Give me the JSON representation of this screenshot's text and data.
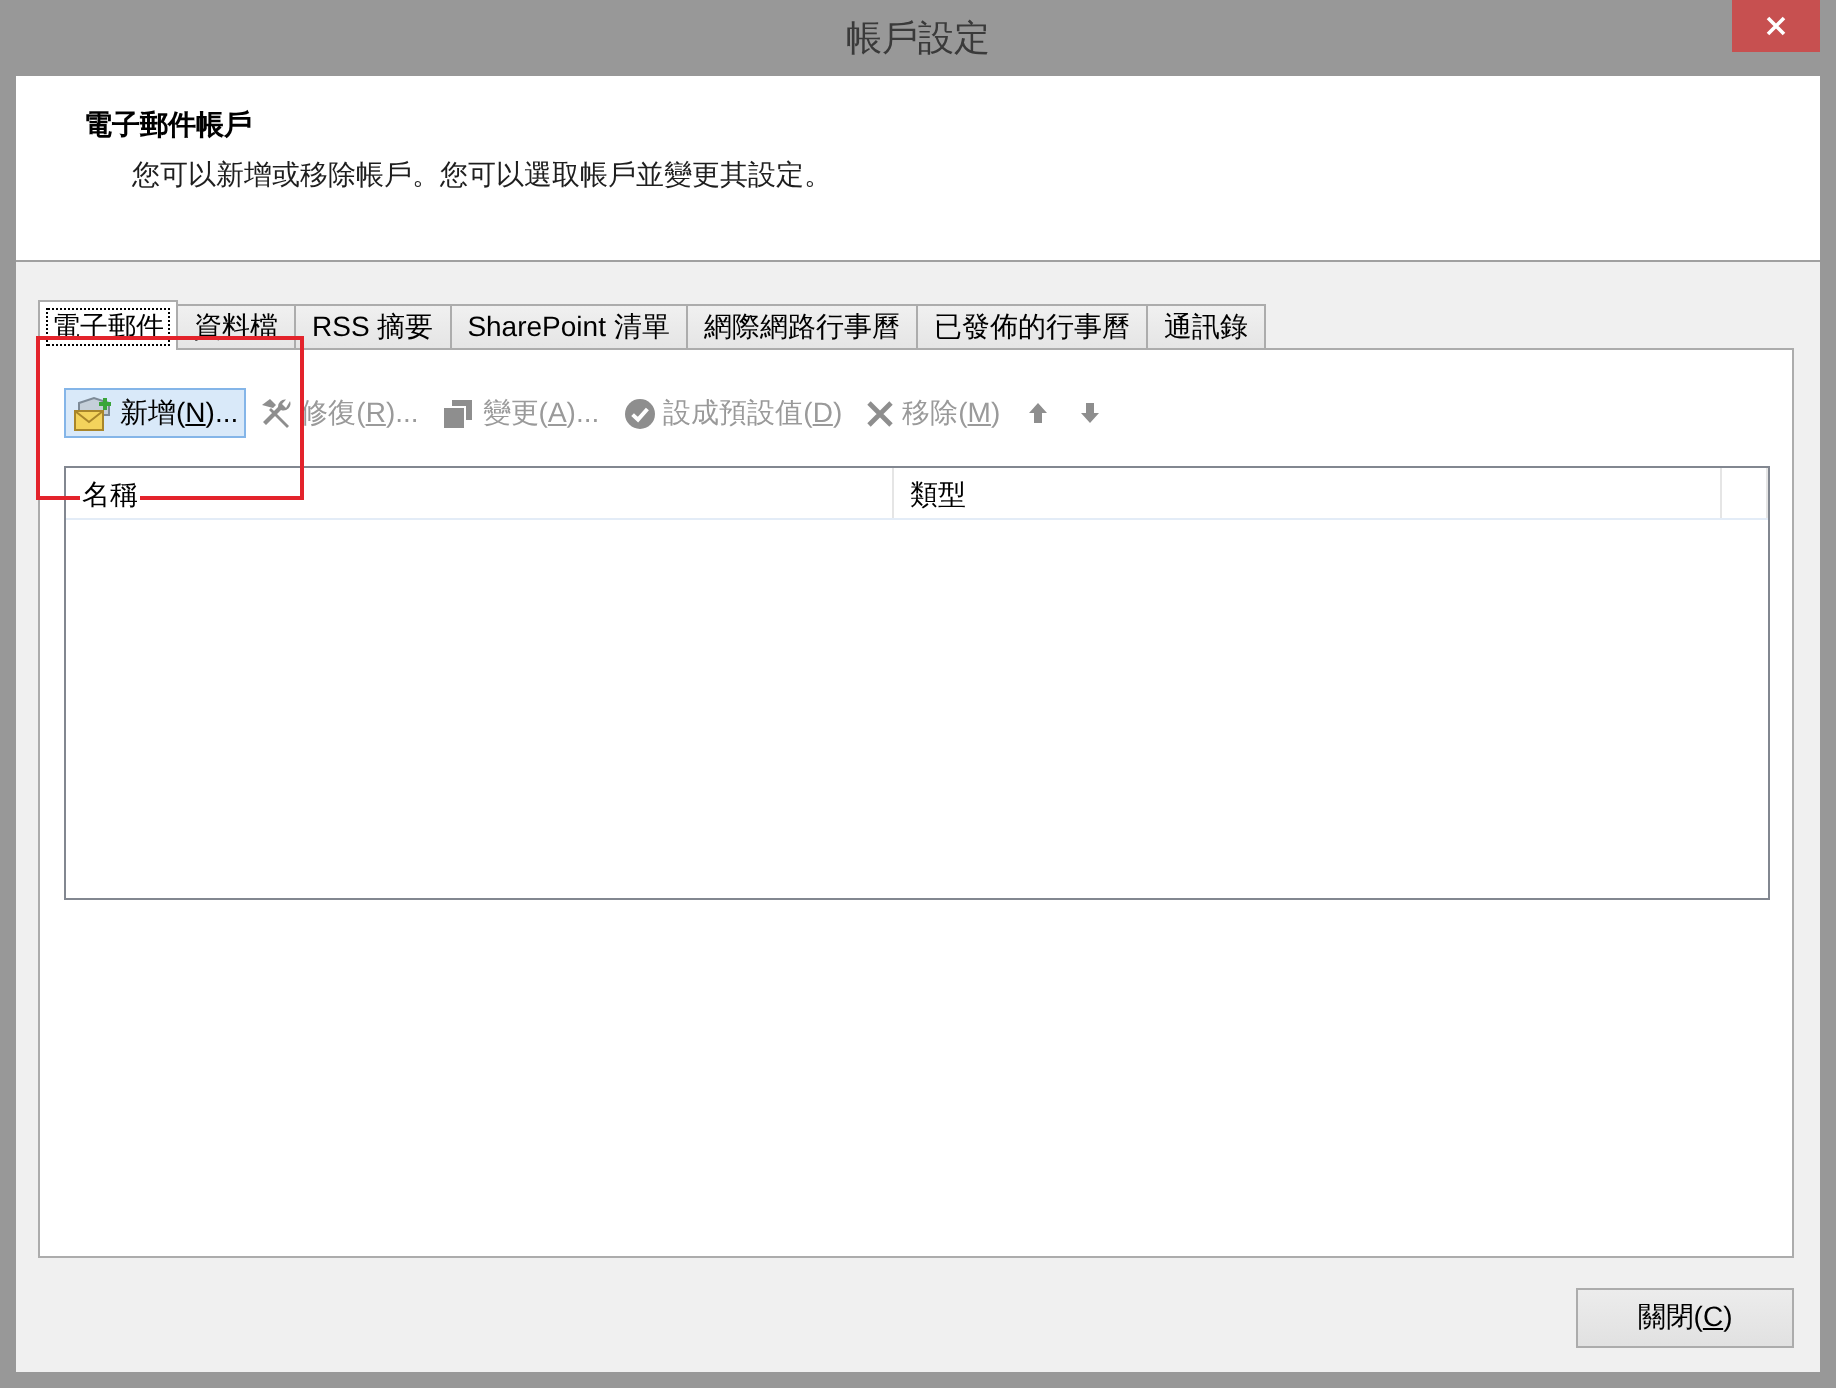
{
  "window": {
    "title": "帳戶設定"
  },
  "header": {
    "title": "電子郵件帳戶",
    "description": "您可以新增或移除帳戶。您可以選取帳戶並變更其設定。"
  },
  "tabs": [
    {
      "label": "電子郵件",
      "selected": true,
      "focused": true
    },
    {
      "label": "資料檔",
      "selected": false,
      "focused": false
    },
    {
      "label": "RSS 摘要",
      "selected": false,
      "focused": false
    },
    {
      "label": "SharePoint 清單",
      "selected": false,
      "focused": false
    },
    {
      "label": "網際網路行事曆",
      "selected": false,
      "focused": false
    },
    {
      "label": "已發佈的行事曆",
      "selected": false,
      "focused": false
    },
    {
      "label": "通訊錄",
      "selected": false,
      "focused": false
    }
  ],
  "toolbar": [
    {
      "kind": "new",
      "text_before": "新增(",
      "access_key": "N",
      "text_after": ")...",
      "disabled": false,
      "highlighted": true
    },
    {
      "kind": "repair",
      "text_before": "修復(",
      "access_key": "R",
      "text_after": ")...",
      "disabled": true,
      "highlighted": false
    },
    {
      "kind": "change",
      "text_before": "變更(",
      "access_key": "A",
      "text_after": ")...",
      "disabled": true,
      "highlighted": false
    },
    {
      "kind": "default",
      "text_before": "設成預設值(",
      "access_key": "D",
      "text_after": ")",
      "disabled": true,
      "highlighted": false
    },
    {
      "kind": "remove",
      "text_before": "移除(",
      "access_key": "M",
      "text_after": ")",
      "disabled": true,
      "highlighted": false
    },
    {
      "kind": "up",
      "disabled": true,
      "highlighted": false
    },
    {
      "kind": "down",
      "disabled": true,
      "highlighted": false
    }
  ],
  "account_list": {
    "columns": [
      "名稱",
      "類型"
    ]
  },
  "footer": {
    "close_button": {
      "text_before": "關閉(",
      "access_key": "C",
      "text_after": ")"
    }
  },
  "annotations": [
    {
      "kind": "frame"
    }
  ]
}
